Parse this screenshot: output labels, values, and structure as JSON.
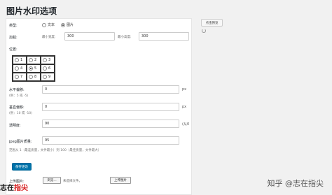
{
  "page": {
    "title": "图片水印选项"
  },
  "type_row": {
    "label": "类型:",
    "option_text": "文本",
    "option_image": "图片",
    "selected": "image"
  },
  "size_row": {
    "label": "加载:",
    "min_width_label": "最小宽度:",
    "min_width_value": "300",
    "min_height_label": "最小高度:",
    "min_height_value": "300"
  },
  "position": {
    "label": "位置:",
    "cells": [
      "1",
      "2",
      "3",
      "4",
      "5",
      "6",
      "7",
      "8",
      "9"
    ],
    "selected": "5"
  },
  "h_offset": {
    "label": "水平偏移:",
    "hint": "(例：5 或 -5)",
    "value": "0",
    "unit": "px"
  },
  "v_offset": {
    "label": "垂直偏移:",
    "hint": "(例：10 或 -10)",
    "value": "0",
    "unit": "px"
  },
  "opacity": {
    "label": "透明度:",
    "value": "90",
    "unit": "(从0"
  },
  "jpeg_quality": {
    "label": "jpeg图片质量:",
    "value": "95",
    "hint": "范围从 1（最差质量，文件最小）到 100（最佳质量，文件最大）"
  },
  "save": {
    "label": "保存更改"
  },
  "upload": {
    "label": "上传图片:",
    "browse_label": "浏览...",
    "no_file_text": "未选择文件。",
    "upload_label": "上传图片"
  },
  "side": {
    "preview_label": "点击预览"
  },
  "overlay": {
    "watermark_text": "知乎 @志在指尖",
    "logo_part1": "志在",
    "logo_part2": "指尖"
  }
}
